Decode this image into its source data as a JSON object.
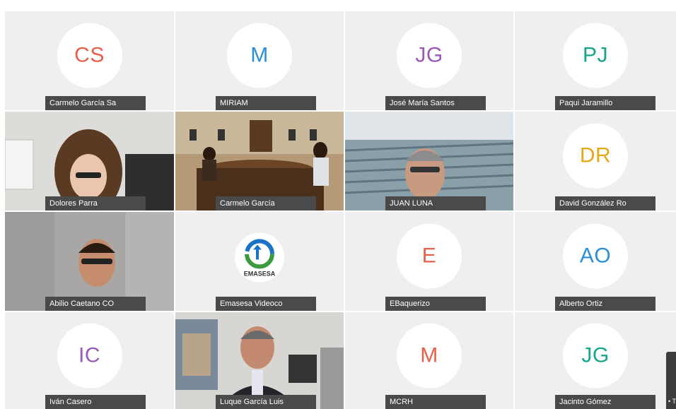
{
  "participants": [
    {
      "name": "Carmelo García Sa",
      "initials": "CS",
      "color": "#e8604c",
      "video": false
    },
    {
      "name": "MIRIAM",
      "initials": "M",
      "color": "#2a8fd6",
      "video": false
    },
    {
      "name": "José María Santos",
      "initials": "JG",
      "color": "#9b59b6",
      "video": false
    },
    {
      "name": "Paqui Jaramillo",
      "initials": "PJ",
      "color": "#17a589",
      "video": false
    },
    {
      "name": "Dolores Parra",
      "video": true
    },
    {
      "name": "Carmelo García",
      "video": true
    },
    {
      "name": "JUAN LUNA",
      "video": true
    },
    {
      "name": "David González Ro",
      "initials": "DR",
      "color": "#e6a817",
      "video": false
    },
    {
      "name": "Abilio Caetano CO",
      "video": true
    },
    {
      "name": "Emasesa Videoco",
      "logo_text": "EMASESA",
      "video": true
    },
    {
      "name": "EBaquerizo",
      "initials": "E",
      "color": "#e8604c",
      "video": false
    },
    {
      "name": "Alberto Ortiz",
      "initials": "AO",
      "color": "#2a8fd6",
      "video": false
    },
    {
      "name": "Iván Casero",
      "initials": "IC",
      "color": "#9b59b6",
      "video": false
    },
    {
      "name": "Luque García Luis",
      "video": true
    },
    {
      "name": "MCRH",
      "initials": "M",
      "color": "#e8604c",
      "video": false
    },
    {
      "name": "Jacinto Gómez",
      "initials": "JG",
      "color": "#17a589",
      "video": false
    }
  ]
}
